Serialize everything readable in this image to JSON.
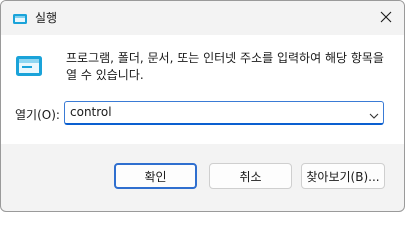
{
  "window": {
    "title": "실행"
  },
  "content": {
    "description": "프로그램, 폴더, 문서, 또는 인터넷 주소를 입력하여 해당 항목을 열 수 있습니다.",
    "open_label": "열기(O):",
    "open_value": "control"
  },
  "buttons": {
    "ok_label": "확인",
    "cancel_label": "취소",
    "browse_label": "찾아보기(B)..."
  },
  "icons": {
    "app": "run-icon",
    "close": "close-icon",
    "dropdown": "chevron-down-icon"
  },
  "colors": {
    "accent": "#0a5fd0",
    "icon_cyan": "#1aa3d9"
  }
}
